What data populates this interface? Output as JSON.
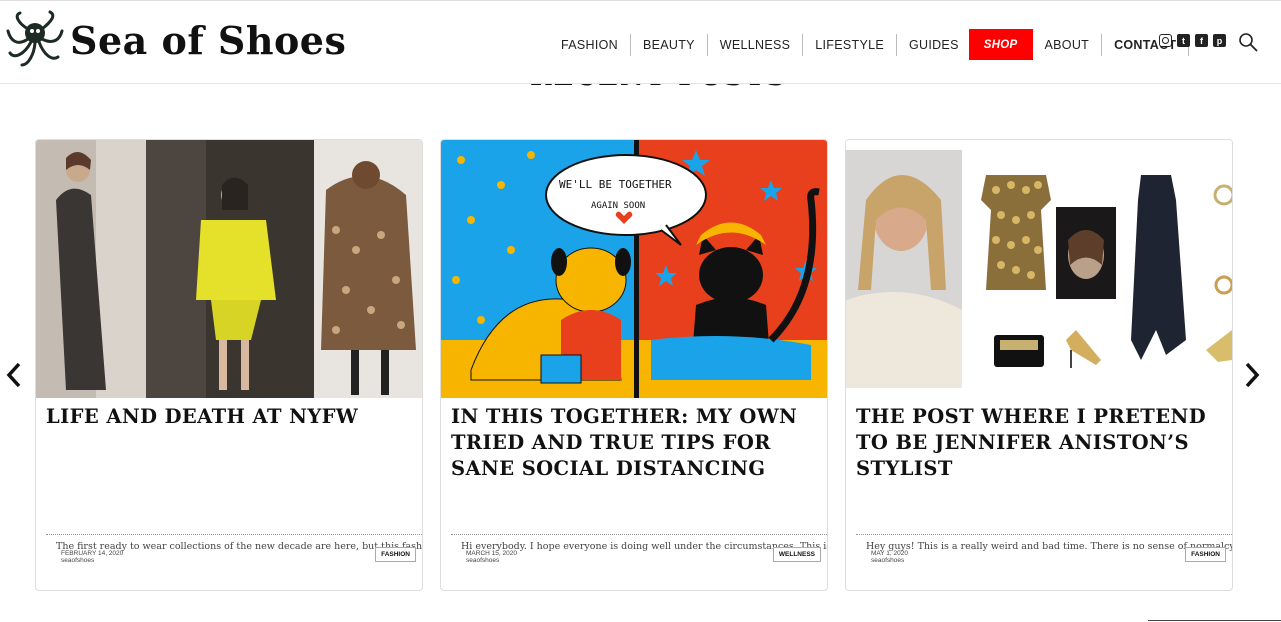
{
  "site": {
    "name": "Sea of Shoes",
    "logo_icon": "octopus-icon"
  },
  "nav": {
    "items": [
      "FASHION",
      "BEAUTY",
      "WELLNESS",
      "LIFESTYLE",
      "GUIDES"
    ],
    "shop": "SHOP",
    "about": "ABOUT",
    "contact": "CONTACT"
  },
  "socials": [
    "instagram-icon",
    "twitter-icon",
    "facebook-icon",
    "pinterest-icon"
  ],
  "section_title": "RECENT POSTS",
  "posts": [
    {
      "title": "LIFE AND DEATH AT NYFW",
      "excerpt": "The first ready to wear collections of the new decade are here, but this fashion wee",
      "date": "FEBRUARY 14, 2020",
      "author": "seaofshoes",
      "category": "FASHION"
    },
    {
      "title": "IN THIS TOGETHER: MY OWN TRIED AND TRUE TIPS FOR SANE SOCIAL DISTANCING",
      "excerpt": "Hi everybody. I hope everyone is doing well under the circumstances. This is a very",
      "date": "MARCH 15, 2020",
      "author": "seaofshoes",
      "category": "WELLNESS",
      "speech_bubble": [
        "WE'LL BE TOGETHER",
        "AGAIN SOON"
      ]
    },
    {
      "title": "THE POST WHERE I PRETEND TO BE JENNIFER ANISTON’S STYLIST",
      "excerpt": "Hey guys! This is a really weird and bad time. There is no sense of normalcy or safe",
      "date": "MAY 1, 2020",
      "author": "seaofshoes",
      "category": "FASHION"
    }
  ],
  "colors": {
    "shop_bg": "#ff0000",
    "illustration_blue": "#1aa3e8",
    "illustration_red": "#e8401c",
    "illustration_yellow": "#f7b500"
  }
}
